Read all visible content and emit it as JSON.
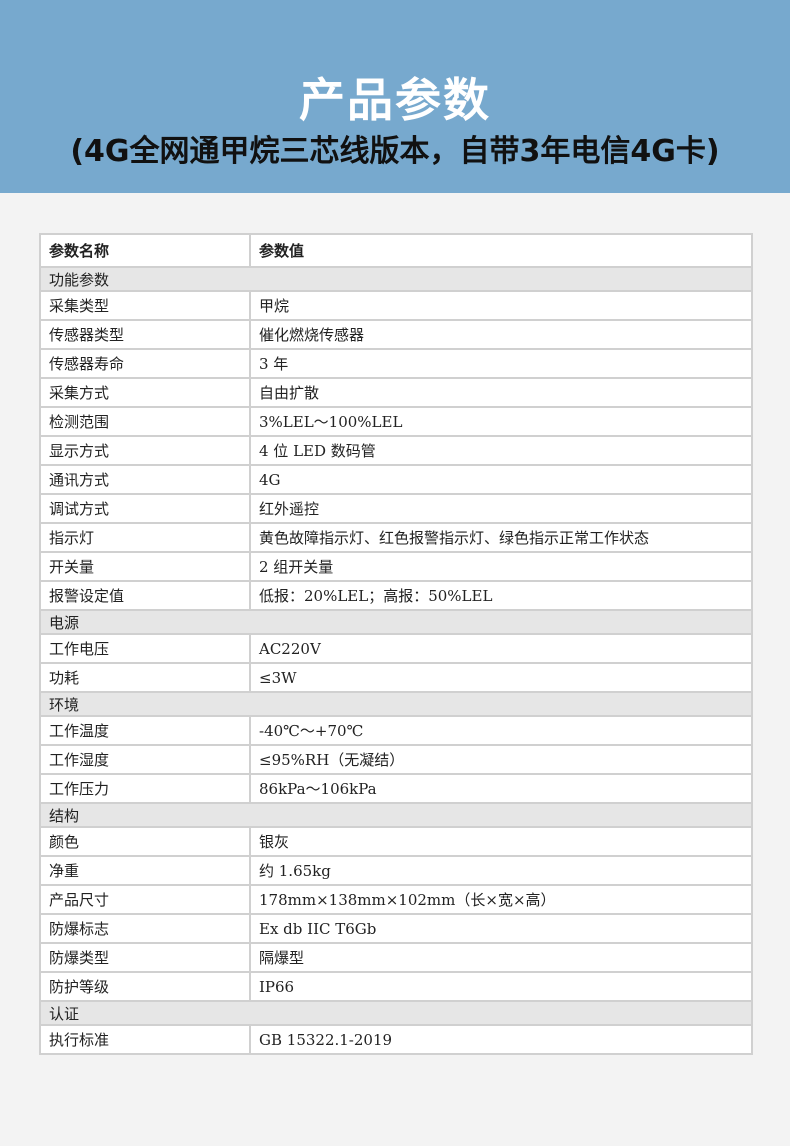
{
  "banner": {
    "title": "产品参数",
    "subtitle": "(4G全网通甲烷三芯线版本，自带3年电信4G卡)"
  },
  "table": {
    "headers": [
      "参数名称",
      "参数值"
    ],
    "sections": [
      {
        "name": "功能参数",
        "rows": [
          [
            "采集类型",
            "甲烷"
          ],
          [
            "传感器类型",
            "催化燃烧传感器"
          ],
          [
            "传感器寿命",
            "3 年"
          ],
          [
            "采集方式",
            "自由扩散"
          ],
          [
            "检测范围",
            "3%LEL～100%LEL"
          ],
          [
            "显示方式",
            "4 位 LED 数码管"
          ],
          [
            "通讯方式",
            "4G"
          ],
          [
            "调试方式",
            "红外遥控"
          ],
          [
            "指示灯",
            "黄色故障指示灯、红色报警指示灯、绿色指示正常工作状态"
          ],
          [
            "开关量",
            "2 组开关量"
          ],
          [
            "报警设定值",
            "低报：20%LEL；高报：50%LEL"
          ]
        ]
      },
      {
        "name": "电源",
        "rows": [
          [
            "工作电压",
            "AC220V"
          ],
          [
            "功耗",
            "≤3W"
          ]
        ]
      },
      {
        "name": "环境",
        "rows": [
          [
            "工作温度",
            "-40℃～+70℃"
          ],
          [
            "工作湿度",
            "≤95%RH（无凝结）"
          ],
          [
            "工作压力",
            "86kPa～106kPa"
          ]
        ]
      },
      {
        "name": "结构",
        "rows": [
          [
            "颜色",
            "银灰"
          ],
          [
            "净重",
            "约 1.65kg"
          ],
          [
            "产品尺寸",
            "178mm×138mm×102mm（长×宽×高）"
          ],
          [
            "防爆标志",
            "Ex db IIC T6Gb"
          ],
          [
            "防爆类型",
            "隔爆型"
          ],
          [
            "防护等级",
            "IP66"
          ]
        ]
      },
      {
        "name": "认证",
        "rows": [
          [
            "执行标准",
            "GB 15322.1-2019"
          ]
        ]
      }
    ]
  }
}
